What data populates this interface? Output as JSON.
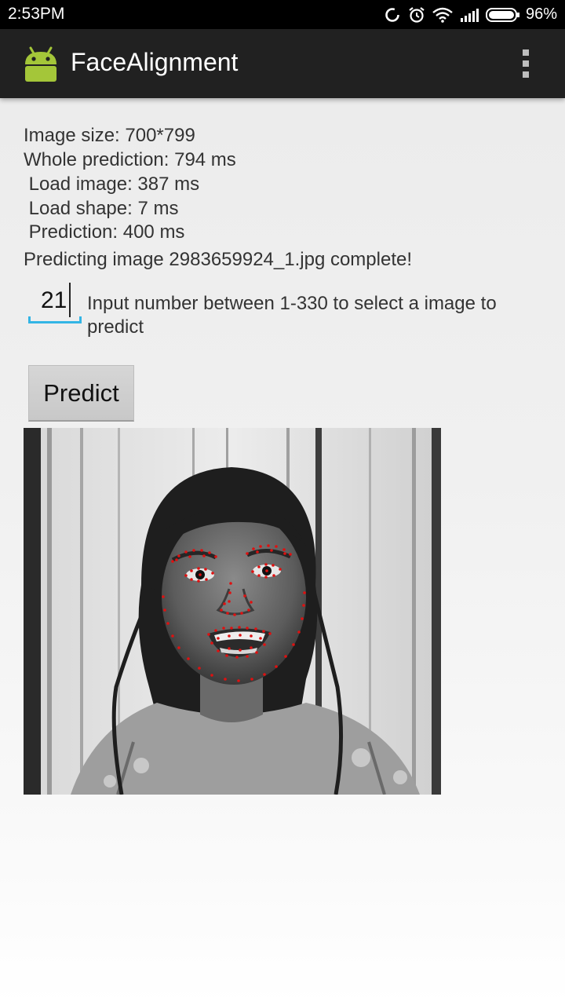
{
  "status_bar": {
    "time": "2:53PM",
    "battery_percent": "96%",
    "icons": [
      "sync-icon",
      "alarm-icon",
      "wifi-icon",
      "signal-icon",
      "battery-icon"
    ]
  },
  "app_bar": {
    "title": "FaceAlignment",
    "app_icon": "android-icon",
    "overflow_icon": "overflow-menu-icon",
    "background": "#212121"
  },
  "stats": {
    "image_size": "Image size: 700*799",
    "whole_prediction": "Whole prediction: 794 ms",
    "load_image": " Load image: 387 ms",
    "load_shape": " Load shape: 7 ms",
    "prediction": " Prediction: 400 ms"
  },
  "status_message": "Predicting image 2983659924_1.jpg complete!",
  "image_selector": {
    "value": "21",
    "hint": "Input number between 1-330 to select a image to predict",
    "accent": "#33b5e5"
  },
  "predict_button": {
    "label": "Predict"
  },
  "result_image": {
    "description_icon": "face-landmark-photo",
    "landmark_color": "#e01010"
  }
}
